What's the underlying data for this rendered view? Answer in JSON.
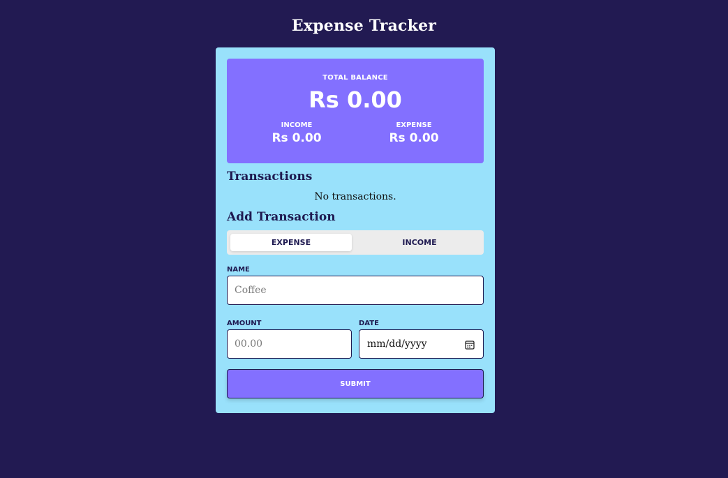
{
  "app": {
    "title": "Expense Tracker"
  },
  "summary": {
    "total_label": "TOTAL BALANCE",
    "total_value": "Rs 0.00",
    "income_label": "INCOME",
    "income_value": "Rs 0.00",
    "expense_label": "EXPENSE",
    "expense_value": "Rs 0.00"
  },
  "transactions": {
    "heading": "Transactions",
    "empty_message": "No transactions."
  },
  "form": {
    "heading": "Add Transaction",
    "type_toggle": {
      "expense_label": "EXPENSE",
      "income_label": "INCOME",
      "selected": "EXPENSE"
    },
    "name": {
      "label": "NAME",
      "placeholder": "Coffee",
      "value": ""
    },
    "amount": {
      "label": "AMOUNT",
      "placeholder": "00.00",
      "value": ""
    },
    "date": {
      "label": "DATE",
      "placeholder": "mm/dd/yyyy",
      "value": ""
    },
    "submit_label": "SUBMIT"
  },
  "colors": {
    "background": "#221a52",
    "card": "#99e1fb",
    "accent": "#8370ff",
    "text_dark": "#1e1950"
  },
  "icons": {
    "date_picker": "calendar-icon"
  }
}
